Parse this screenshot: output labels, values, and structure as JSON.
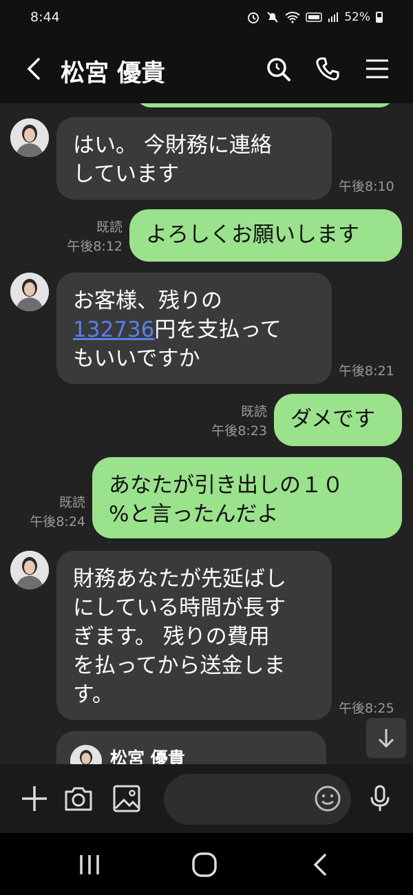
{
  "status_bar": {
    "time": "8:44",
    "battery": "52%"
  },
  "header": {
    "contact_name": "松宮 優貴"
  },
  "messages": [
    {
      "direction": "in",
      "lines": [
        "はい。 今財務に連絡",
        "しています"
      ],
      "time": "午後8:10"
    },
    {
      "direction": "out",
      "text": "よろしくお願いします",
      "read": "既読",
      "time": "午後8:12"
    },
    {
      "direction": "in",
      "line1": "お客様、残りの",
      "amount": "132736",
      "line2_rest": "円を支払って",
      "line3": "もいいですか",
      "time": "午後8:21"
    },
    {
      "direction": "out",
      "text": "ダメです",
      "read": "既読",
      "time": "午後8:23"
    },
    {
      "direction": "out",
      "lines": [
        "あなたが引き出しの１０",
        "%と言ったんだよ"
      ],
      "read": "既読",
      "time": "午後8:24"
    },
    {
      "direction": "in",
      "lines": [
        "財務あなたが先延ばし",
        "にしている時間が長す",
        "ぎます。 残りの費用",
        "を払ってから送金しま",
        "す。"
      ],
      "time": "午後8:25"
    },
    {
      "direction": "in",
      "type": "contact_card",
      "name": "松宮 優貴"
    }
  ],
  "input": {
    "placeholder": ""
  },
  "colors": {
    "outgoing": "#9be28c",
    "incoming": "#3a3a3a",
    "background": "#222222",
    "link": "#5b7fe8"
  }
}
